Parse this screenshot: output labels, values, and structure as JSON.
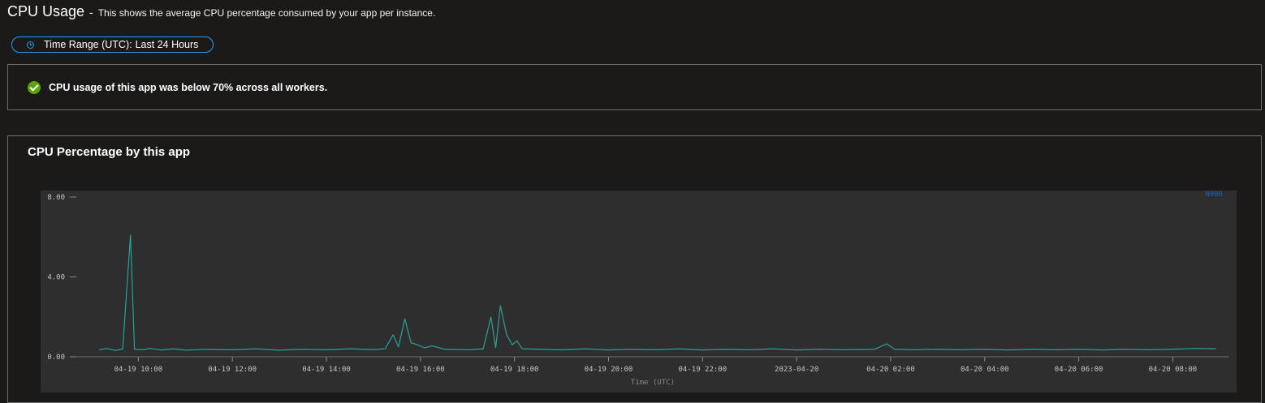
{
  "header": {
    "title": "CPU Usage",
    "separator": "-",
    "description": "This shows the average CPU percentage consumed by your app per instance."
  },
  "time_range": {
    "label": "Time Range (UTC):",
    "value": "Last 24 Hours",
    "icon": "clock-icon",
    "accent": "#2899f5"
  },
  "status": {
    "icon": "success-check-icon",
    "color": "#57a300",
    "text": "CPU usage of this app was below 70% across all workers."
  },
  "chart_card": {
    "title": "CPU Percentage by this app"
  },
  "chart_data": {
    "type": "line",
    "xlabel": "Time (UTC)",
    "ylabel": "",
    "ylim": [
      0,
      8
    ],
    "y_ticks": [
      {
        "value": 0,
        "label": "0.00"
      },
      {
        "value": 4,
        "label": "4.00"
      },
      {
        "value": 8,
        "label": "8.00"
      }
    ],
    "x_start": "2023-04-19 08:45",
    "x_end": "2023-04-20 09:10",
    "x_ticks": [
      {
        "time": "2023-04-19 10:00",
        "label": "04-19 10:00"
      },
      {
        "time": "2023-04-19 12:00",
        "label": "04-19 12:00"
      },
      {
        "time": "2023-04-19 14:00",
        "label": "04-19 14:00"
      },
      {
        "time": "2023-04-19 16:00",
        "label": "04-19 16:00"
      },
      {
        "time": "2023-04-19 18:00",
        "label": "04-19 18:00"
      },
      {
        "time": "2023-04-19 20:00",
        "label": "04-19 20:00"
      },
      {
        "time": "2023-04-19 22:00",
        "label": "04-19 22:00"
      },
      {
        "time": "2023-04-20 00:00",
        "label": "2023-04-20"
      },
      {
        "time": "2023-04-20 02:00",
        "label": "04-20 02:00"
      },
      {
        "time": "2023-04-20 04:00",
        "label": "04-20 04:00"
      },
      {
        "time": "2023-04-20 06:00",
        "label": "04-20 06:00"
      },
      {
        "time": "2023-04-20 08:00",
        "label": "04-20 08:00"
      }
    ],
    "grid": false,
    "legend_position": "top-right",
    "series": [
      {
        "name": "N006",
        "color": "#2aa198",
        "legend_color": "#1f5fbf",
        "points": [
          [
            "2023-04-19 09:10",
            0.35
          ],
          [
            "2023-04-19 09:20",
            0.42
          ],
          [
            "2023-04-19 09:30",
            0.32
          ],
          [
            "2023-04-19 09:40",
            0.38
          ],
          [
            "2023-04-19 09:50",
            6.1
          ],
          [
            "2023-04-19 09:55",
            0.38
          ],
          [
            "2023-04-19 10:05",
            0.35
          ],
          [
            "2023-04-19 10:15",
            0.42
          ],
          [
            "2023-04-19 10:30",
            0.34
          ],
          [
            "2023-04-19 10:45",
            0.4
          ],
          [
            "2023-04-19 11:00",
            0.33
          ],
          [
            "2023-04-19 11:30",
            0.38
          ],
          [
            "2023-04-19 12:00",
            0.35
          ],
          [
            "2023-04-19 12:30",
            0.4
          ],
          [
            "2023-04-19 13:00",
            0.33
          ],
          [
            "2023-04-19 13:30",
            0.38
          ],
          [
            "2023-04-19 14:00",
            0.35
          ],
          [
            "2023-04-19 14:30",
            0.4
          ],
          [
            "2023-04-19 15:00",
            0.36
          ],
          [
            "2023-04-19 15:15",
            0.4
          ],
          [
            "2023-04-19 15:25",
            1.1
          ],
          [
            "2023-04-19 15:32",
            0.5
          ],
          [
            "2023-04-19 15:40",
            1.9
          ],
          [
            "2023-04-19 15:48",
            0.7
          ],
          [
            "2023-04-19 15:55",
            0.62
          ],
          [
            "2023-04-19 16:05",
            0.45
          ],
          [
            "2023-04-19 16:15",
            0.55
          ],
          [
            "2023-04-19 16:30",
            0.38
          ],
          [
            "2023-04-19 17:00",
            0.35
          ],
          [
            "2023-04-19 17:20",
            0.4
          ],
          [
            "2023-04-19 17:30",
            2.0
          ],
          [
            "2023-04-19 17:36",
            0.45
          ],
          [
            "2023-04-19 17:42",
            2.55
          ],
          [
            "2023-04-19 17:50",
            1.1
          ],
          [
            "2023-04-19 17:57",
            0.6
          ],
          [
            "2023-04-19 18:03",
            0.8
          ],
          [
            "2023-04-19 18:10",
            0.4
          ],
          [
            "2023-04-19 18:30",
            0.38
          ],
          [
            "2023-04-19 19:00",
            0.35
          ],
          [
            "2023-04-19 19:30",
            0.4
          ],
          [
            "2023-04-19 20:00",
            0.34
          ],
          [
            "2023-04-19 20:30",
            0.38
          ],
          [
            "2023-04-19 21:00",
            0.35
          ],
          [
            "2023-04-19 21:30",
            0.4
          ],
          [
            "2023-04-19 22:00",
            0.34
          ],
          [
            "2023-04-19 22:30",
            0.38
          ],
          [
            "2023-04-19 23:00",
            0.35
          ],
          [
            "2023-04-19 23:30",
            0.4
          ],
          [
            "2023-04-20 00:00",
            0.34
          ],
          [
            "2023-04-20 00:30",
            0.38
          ],
          [
            "2023-04-20 01:00",
            0.35
          ],
          [
            "2023-04-20 01:40",
            0.38
          ],
          [
            "2023-04-20 01:55",
            0.65
          ],
          [
            "2023-04-20 02:05",
            0.38
          ],
          [
            "2023-04-20 02:30",
            0.35
          ],
          [
            "2023-04-20 03:00",
            0.38
          ],
          [
            "2023-04-20 03:30",
            0.35
          ],
          [
            "2023-04-20 04:00",
            0.38
          ],
          [
            "2023-04-20 04:30",
            0.34
          ],
          [
            "2023-04-20 05:00",
            0.38
          ],
          [
            "2023-04-20 05:30",
            0.35
          ],
          [
            "2023-04-20 06:00",
            0.38
          ],
          [
            "2023-04-20 06:30",
            0.34
          ],
          [
            "2023-04-20 07:00",
            0.38
          ],
          [
            "2023-04-20 07:30",
            0.35
          ],
          [
            "2023-04-20 08:00",
            0.38
          ],
          [
            "2023-04-20 08:30",
            0.42
          ],
          [
            "2023-04-20 08:55",
            0.4
          ]
        ]
      }
    ]
  }
}
